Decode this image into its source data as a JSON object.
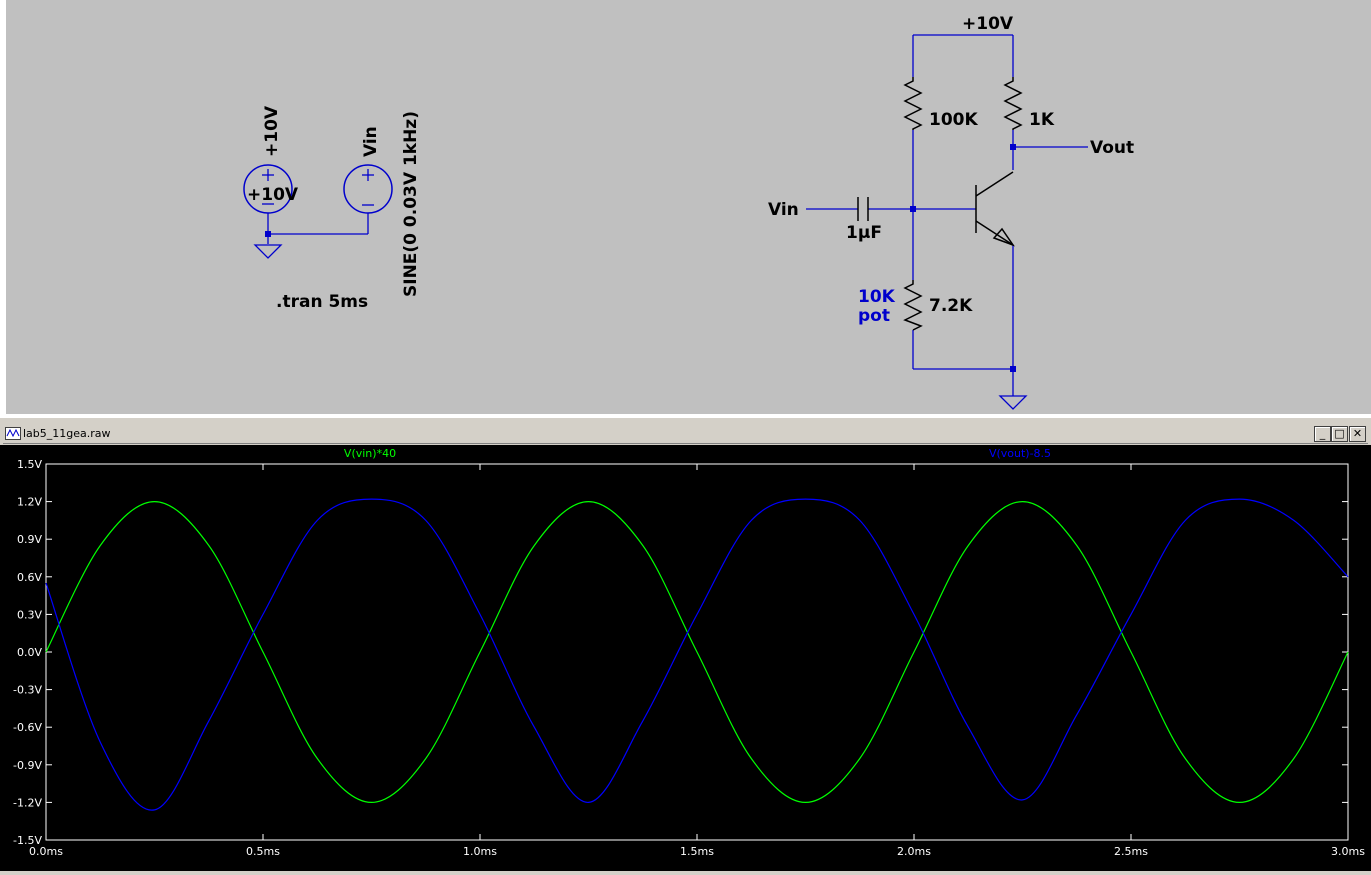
{
  "schematic": {
    "supply_source": {
      "net_label": "+10V",
      "value": "+10V"
    },
    "input_source": {
      "net_label": "Vin",
      "value": "SINE(0 0.03V 1kHz)"
    },
    "directive": ".tran 5ms",
    "amplifier": {
      "supply_label": "+10V",
      "r_bias_top": "100K",
      "r_collector": "1K",
      "output_label": "Vout",
      "input_label": "Vin",
      "capacitor": "1µF",
      "pot_label_1": "10K",
      "pot_label_2": "pot",
      "r_bias_bottom": "7.2K"
    }
  },
  "plot_window": {
    "title": "lab5_11gea.raw",
    "buttons": {
      "minimize": "_",
      "maximize": "□",
      "close": "✕"
    }
  },
  "chart_data": {
    "type": "line",
    "title": "",
    "xlabel": "",
    "ylabel": "",
    "xlim": [
      0,
      3.0
    ],
    "ylim": [
      -1.5,
      1.5
    ],
    "x_unit": "ms",
    "y_unit": "V",
    "x_ticks": [
      "0.0ms",
      "0.5ms",
      "1.0ms",
      "1.5ms",
      "2.0ms",
      "2.5ms",
      "3.0ms"
    ],
    "y_ticks": [
      "1.5V",
      "1.2V",
      "0.9V",
      "0.6V",
      "0.3V",
      "0.0V",
      "-0.3V",
      "-0.6V",
      "-0.9V",
      "-1.2V",
      "-1.5V"
    ],
    "grid": false,
    "series": [
      {
        "name": "V(vin)*40",
        "color": "#00ff00",
        "x": [
          0,
          0.125,
          0.25,
          0.375,
          0.5,
          0.625,
          0.75,
          0.875,
          1.0,
          1.125,
          1.25,
          1.375,
          1.5,
          1.625,
          1.75,
          1.875,
          2.0,
          2.125,
          2.25,
          2.375,
          2.5,
          2.625,
          2.75,
          2.875,
          3.0
        ],
        "y": [
          0,
          0.85,
          1.2,
          0.85,
          0,
          -0.85,
          -1.2,
          -0.85,
          0,
          0.85,
          1.2,
          0.85,
          0,
          -0.85,
          -1.2,
          -0.85,
          0,
          0.85,
          1.2,
          0.85,
          0,
          -0.85,
          -1.2,
          -0.85,
          0
        ]
      },
      {
        "name": "V(vout)-8.5",
        "color": "#0000ff",
        "x": [
          0,
          0.125,
          0.25,
          0.375,
          0.5,
          0.625,
          0.75,
          0.875,
          1.0,
          1.125,
          1.25,
          1.375,
          1.5,
          1.625,
          1.75,
          1.875,
          2.0,
          2.125,
          2.25,
          2.375,
          2.5,
          2.625,
          2.75,
          2.875,
          3.0
        ],
        "y": [
          0.55,
          -0.72,
          -1.26,
          -0.55,
          0.3,
          1.05,
          1.22,
          1.05,
          0.3,
          -0.6,
          -1.2,
          -0.55,
          0.3,
          1.05,
          1.22,
          1.05,
          0.3,
          -0.6,
          -1.18,
          -0.5,
          0.3,
          1.05,
          1.22,
          1.05,
          0.6
        ]
      }
    ]
  }
}
